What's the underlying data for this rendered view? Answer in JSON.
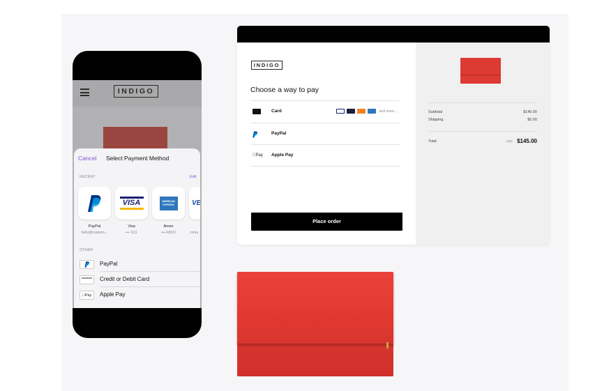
{
  "phone": {
    "logo": "INDIGO",
    "sheet": {
      "cancel_label": "Cancel",
      "title": "Select Payment Method",
      "recent_label": "RECENT",
      "edit_label": "Edit",
      "recent_items": [
        {
          "name": "PayPal",
          "sub": "hello@markom..."
        },
        {
          "name": "Visa",
          "sub": "••• 1111"
        },
        {
          "name": "Amex",
          "sub": "••• 43002"
        },
        {
          "name": "",
          "sub": "mma"
        }
      ],
      "other_label": "OTHER",
      "other_items": [
        {
          "label": "PayPal"
        },
        {
          "label": "Credit or Debit Card"
        },
        {
          "label": "Apple Pay"
        }
      ],
      "tile_visa_text": "VISA",
      "tile_amex_text": "AMERICAN EXPRESS",
      "tile_partial_text": "VE",
      "applepay_badge": "Pay"
    }
  },
  "checkout": {
    "logo": "INDIGO",
    "heading": "Choose a way to pay",
    "methods": [
      {
        "label": "Card"
      },
      {
        "label": "PayPal"
      },
      {
        "label": "Apple Pay"
      }
    ],
    "card_more": "and more...",
    "apple_pay_icon_text": "Pay",
    "place_order_label": "Place order",
    "summary": {
      "subtotal_label": "Subtotal",
      "subtotal_value": "$140.00",
      "shipping_label": "Shipping",
      "shipping_value": "$5.00",
      "total_label": "Total",
      "total_currency": "USD",
      "total_value": "$145.00"
    }
  },
  "colors": {
    "accent_purple": "#7b52d6",
    "product_red": "#e0382f",
    "black": "#000000"
  }
}
